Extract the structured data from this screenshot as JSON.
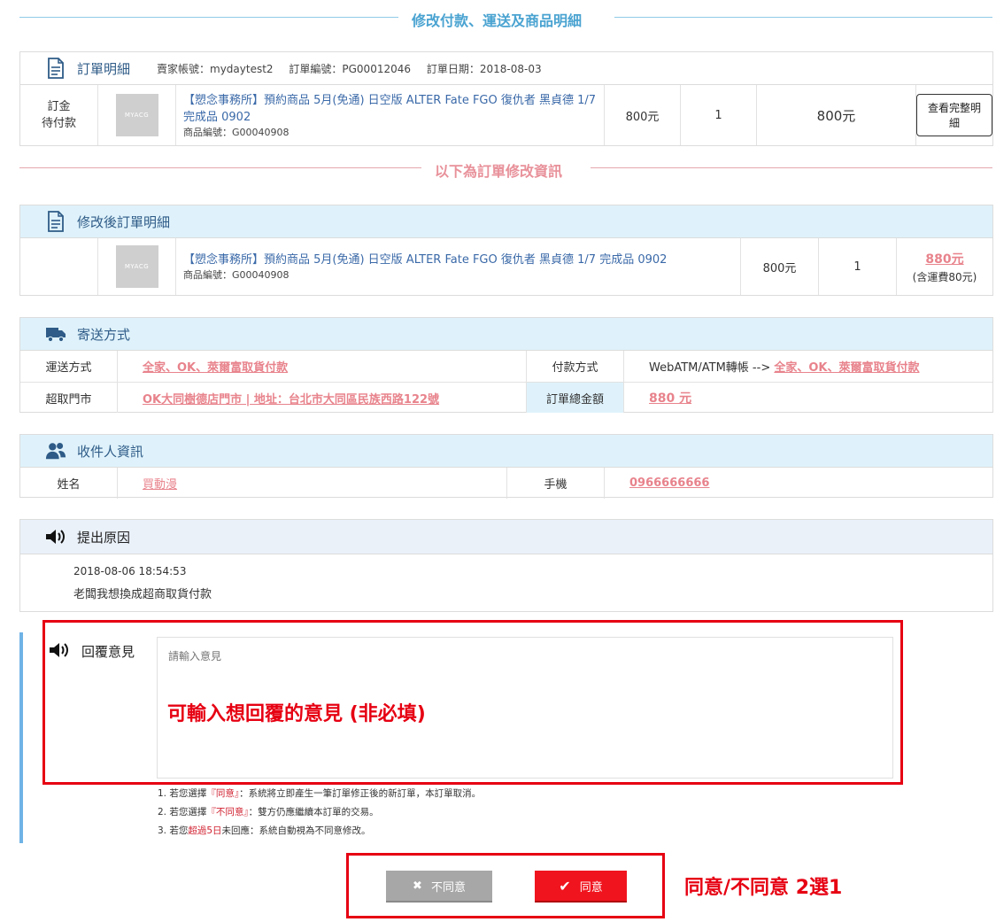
{
  "section_titles": {
    "top": "修改付款、運送及商品明細",
    "middle": "以下為訂單修改資訊"
  },
  "order": {
    "title": "訂單明細",
    "seller": "賣家帳號：mydaytest2",
    "order_no": "訂單編號：PG00012046",
    "order_date": "訂單日期：2018-08-03",
    "status_line1": "訂金",
    "status_line2": "待付款",
    "thumb_text": "MYACG",
    "product_name": "【愬念事務所】預約商品 5月(免通) 日空版 ALTER Fate FGO 復仇者 黑貞德 1/7 完成品 0902",
    "product_code": "商品編號：G00040908",
    "unit_price": "800元",
    "qty": "1",
    "subtotal": "800元",
    "detail_button": "查看完整明細"
  },
  "modified": {
    "title": "修改後訂單明細",
    "thumb_text": "MYACG",
    "product_name": "【愬念事務所】預約商品 5月(免通) 日空版 ALTER Fate FGO 復仇者 黑貞德 1/7 完成品 0902",
    "product_code": "商品編號：G00040908",
    "unit_price": "800元",
    "qty": "1",
    "total": "880元",
    "shipping_note": "(含運費80元)"
  },
  "shipping": {
    "title": "寄送方式",
    "method_label": "運送方式",
    "method_value": "全家、OK、萊爾富取貨付款",
    "payment_label": "付款方式",
    "payment_prefix": "WebATM/ATM轉帳 -->",
    "payment_value": "全家、OK、萊爾富取貨付款",
    "store_label": "超取門市",
    "store_value": "OK大同樹德店門市 | 地址：台北市大同區民族西路122號",
    "total_label": "訂單總金額",
    "total_value": "880 元"
  },
  "recipient": {
    "title": "收件人資訊",
    "name_label": "姓名",
    "name_value": "買動漫",
    "phone_label": "手機",
    "phone_value": "0966666666"
  },
  "reason": {
    "title": "提出原因",
    "timestamp": "2018-08-06 18:54:53",
    "text": "老闆我想換成超商取貨付款"
  },
  "reply": {
    "label": "回覆意見",
    "placeholder": "請輸入意見",
    "annotation": "可輸入想回覆的意見 (非必填)"
  },
  "notes": {
    "n1_pre": "1. 若您選擇",
    "n1_hl": "『同意』",
    "n1_post": "：系統將立即產生一筆訂單修正後的新訂單，本訂單取消。",
    "n2_pre": "2. 若您選擇",
    "n2_hl": "『不同意』",
    "n2_post": "：雙方仍應繼續本訂單的交易。",
    "n3_pre": "3. 若您",
    "n3_hl": "超過5日",
    "n3_post": "未回應：系統自動視為不同意修改。"
  },
  "buttons": {
    "disagree": "不同意",
    "agree": "同意"
  },
  "choice_annotation": "同意/不同意 2選1",
  "colors": {
    "accent_blue": "#4aa3d1",
    "header_bg": "#dff2fb",
    "link_red": "#e8838c",
    "annotation_red": "#e60012",
    "agree_red": "#f0141e",
    "disagree_gray": "#a7a7a7"
  },
  "icons": {
    "order": "document-icon",
    "modified": "document-icon",
    "shipping": "truck-icon",
    "recipient": "users-icon",
    "reason": "speaker-icon",
    "reply": "speaker-icon",
    "disagree": "x-icon",
    "agree": "check-icon"
  }
}
